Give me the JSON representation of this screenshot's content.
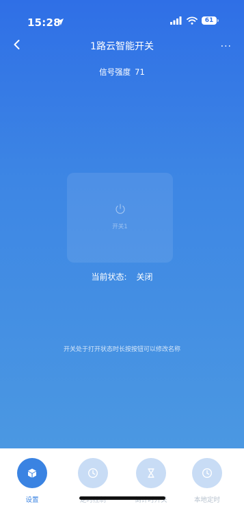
{
  "status_bar": {
    "time": "15:28",
    "battery": "61"
  },
  "nav": {
    "title": "1路云智能开关",
    "more": "···"
  },
  "signal": {
    "label": "信号强度",
    "value": "71"
  },
  "switch": {
    "label": "开关1"
  },
  "current_state": {
    "label": "当前状态:",
    "value": "关闭"
  },
  "hint": "开关处于打开状态时长按按钮可以修改名称",
  "tabs": [
    {
      "label": "设置",
      "icon": "cube-icon",
      "active": true
    },
    {
      "label": "定时控制",
      "icon": "clock-icon",
      "active": false
    },
    {
      "label": "倒计时开关",
      "icon": "hourglass-icon",
      "active": false
    },
    {
      "label": "本地定时",
      "icon": "clock-icon",
      "active": false
    }
  ],
  "colors": {
    "gradient_top": "#2f6fe6",
    "gradient_bottom": "#4b98e2",
    "tab_active": "#3a83e2",
    "tab_inactive": "#c8dcf5"
  }
}
